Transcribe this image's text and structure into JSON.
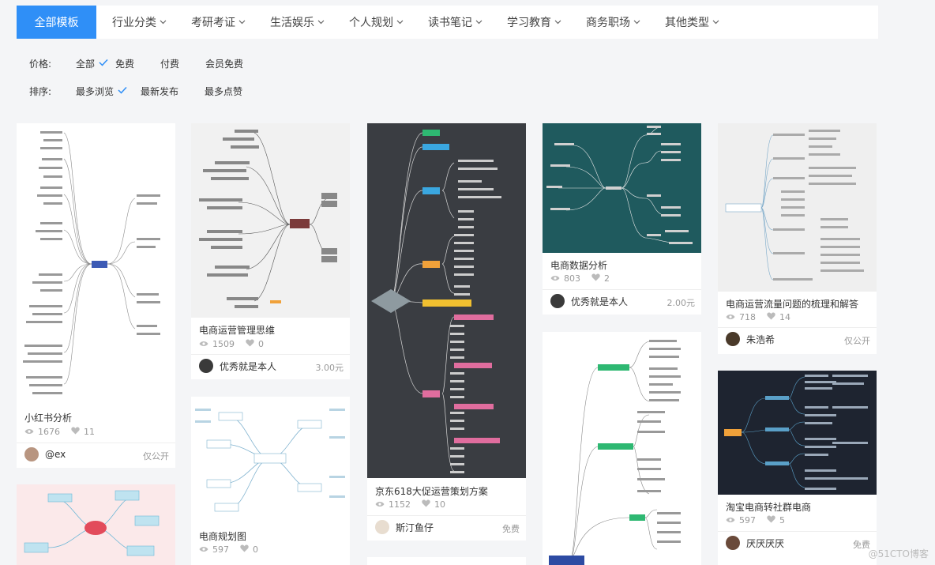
{
  "nav": {
    "tabs": [
      {
        "label": "全部模板",
        "active": true
      },
      {
        "label": "行业分类"
      },
      {
        "label": "考研考证"
      },
      {
        "label": "生活娱乐"
      },
      {
        "label": "个人规划"
      },
      {
        "label": "读书笔记"
      },
      {
        "label": "学习教育"
      },
      {
        "label": "商务职场"
      },
      {
        "label": "其他类型"
      }
    ]
  },
  "filters": {
    "price": {
      "label": "价格:",
      "options": [
        "全部",
        "免费",
        "付费",
        "会员免费"
      ],
      "selected": "全部"
    },
    "sort": {
      "label": "排序:",
      "options": [
        "最多浏览",
        "最新发布",
        "最多点赞"
      ],
      "selected": "最多浏览"
    }
  },
  "cards": [
    {
      "title": "小红书分析",
      "views": "1676",
      "likes": "11",
      "author": "@ex",
      "price": "仅公开",
      "theme": "light"
    },
    {
      "title": "电商运营管理思维",
      "views": "1509",
      "likes": "0",
      "author": "优秀就是本人",
      "price": "3.00元",
      "theme": "gray"
    },
    {
      "title": "京东618大促运营策划方案",
      "views": "1152",
      "likes": "10",
      "author": "斯汀鱼仔",
      "price": "免费",
      "theme": "dark"
    },
    {
      "title": "电商数据分析",
      "views": "803",
      "likes": "2",
      "author": "优秀就是本人",
      "price": "2.00元",
      "theme": "teal"
    },
    {
      "title": "电商运营流量问题的梳理和解答",
      "views": "718",
      "likes": "14",
      "author": "朱浩希",
      "price": "仅公开",
      "theme": "gray"
    },
    {
      "title": "电商规划图",
      "views": "597",
      "likes": "0",
      "author": "",
      "price": "",
      "theme": "light"
    },
    {
      "title": "淘宝电商转社群电商",
      "views": "597",
      "likes": "5",
      "author": "厌厌厌厌",
      "price": "免费",
      "theme": "navy"
    }
  ],
  "colors": {
    "accent": "#2f8ff7",
    "page_bg": "#f4f5f7",
    "dark_map_bg": "#3a3d42",
    "teal_map_bg": "#1f5a5e",
    "navy_map_bg": "#1e2430"
  },
  "watermark": "@51CTO博客"
}
